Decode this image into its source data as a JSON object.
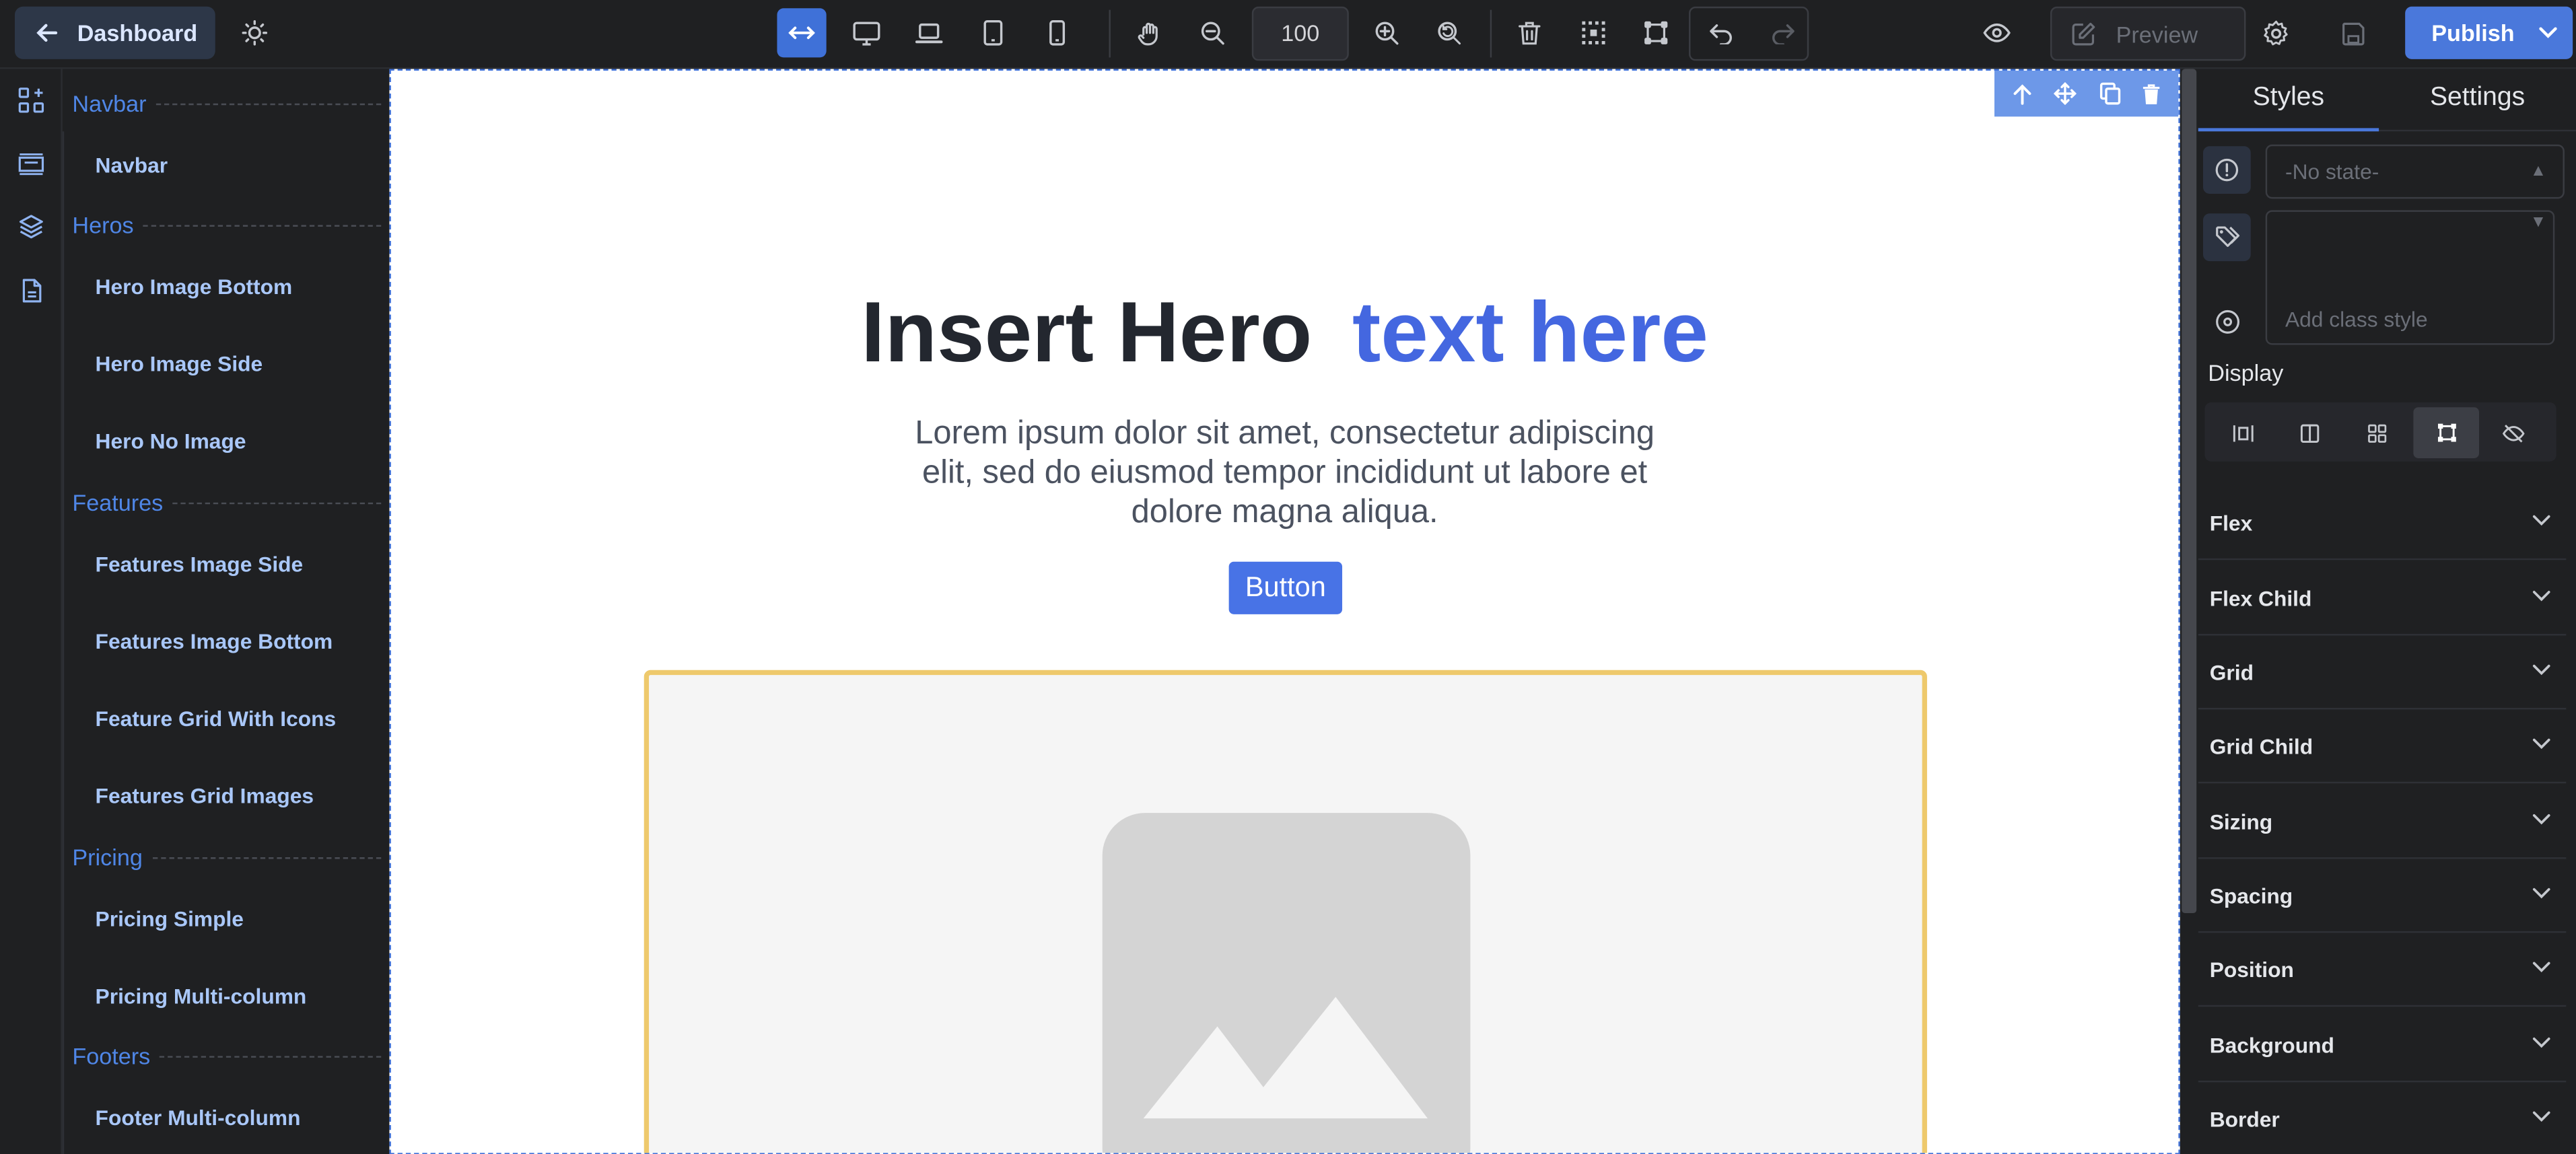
{
  "topbar": {
    "dashboard_label": "Dashboard",
    "zoom_value": "100",
    "preview_label": "Preview",
    "publish_label": "Publish",
    "icons": [
      "arrow-left-icon",
      "sun-icon",
      "fit-width-icon",
      "desktop-icon",
      "laptop-icon",
      "tablet-icon",
      "mobile-icon",
      "pan-hand-icon",
      "zoom-out-icon",
      "zoom-in-icon",
      "zoom-reset-icon",
      "trash-icon",
      "grid-select-icon",
      "frame-icon",
      "undo-icon",
      "redo-icon",
      "eye-icon",
      "edit-icon",
      "gear-icon",
      "save-icon",
      "chevron-down-icon"
    ]
  },
  "rail": {
    "icons": [
      "blocks-icon",
      "components-icon",
      "layers-icon",
      "pages-icon"
    ]
  },
  "blocks": {
    "categories": [
      {
        "label": "Navbar",
        "items": [
          "Navbar"
        ]
      },
      {
        "label": "Heros",
        "items": [
          "Hero Image Bottom",
          "Hero Image Side",
          "Hero No Image"
        ]
      },
      {
        "label": "Features",
        "items": [
          "Features Image Side",
          "Features Image Bottom",
          "Feature Grid With Icons",
          "Features Grid Images"
        ]
      },
      {
        "label": "Pricing",
        "items": [
          "Pricing Simple",
          "Pricing Multi-column"
        ]
      },
      {
        "label": "Footers",
        "items": [
          "Footer Multi-column"
        ]
      }
    ]
  },
  "canvas": {
    "hero_title_main": "Insert Hero",
    "hero_title_accent": "text here",
    "hero_subtitle": "Lorem ipsum dolor sit amet, consectetur adipiscing elit, sed do eiusmod tempor incididunt ut labore et dolore magna aliqua.",
    "hero_button": "Button",
    "selection_toolbar_icons": [
      "select-parent-icon",
      "move-icon",
      "copy-icon",
      "delete-icon"
    ],
    "image_placeholder_icon": "image-placeholder-icon"
  },
  "panel": {
    "tabs": [
      "Styles",
      "Settings"
    ],
    "active_tab": "Styles",
    "state_placeholder": "-No state-",
    "class_placeholder": "Add class style",
    "display_label": "Display",
    "display_options": [
      "display-block-icon",
      "display-flex-icon",
      "display-grid-icon",
      "display-inline-icon",
      "display-none-icon"
    ],
    "display_selected": 3,
    "sections": [
      "Flex",
      "Flex Child",
      "Grid",
      "Grid Child",
      "Sizing",
      "Spacing",
      "Position",
      "Background",
      "Border"
    ]
  },
  "colors": {
    "accent": "#4a78db",
    "category_text": "#4f86e6",
    "block_text": "#a9c7f8",
    "hero_accent": "#4467e0",
    "image_frame_border": "#eec96c"
  }
}
